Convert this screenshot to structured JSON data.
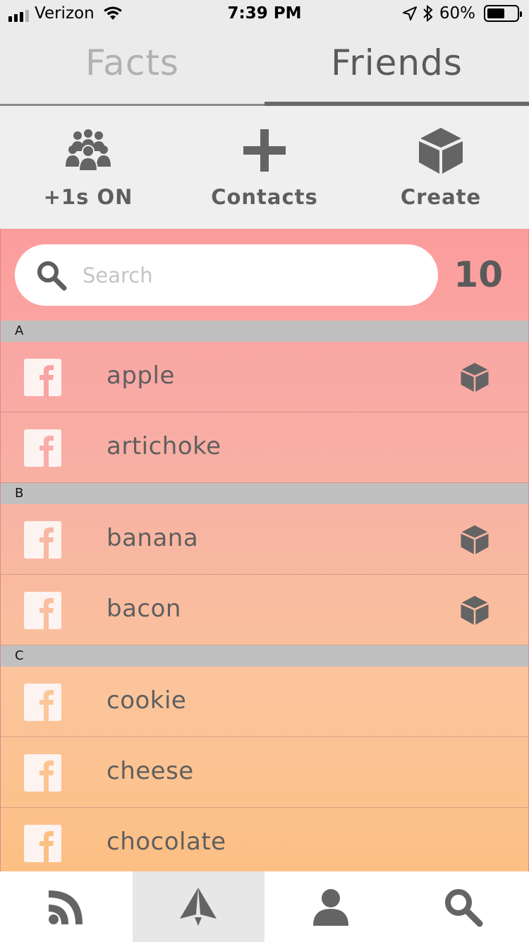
{
  "status_bar": {
    "carrier": "Verizon",
    "time": "7:39 PM",
    "battery_percent": "60%",
    "battery_level": 0.6
  },
  "top_tabs": [
    {
      "label": "Facts",
      "active": false
    },
    {
      "label": "Friends",
      "active": true
    }
  ],
  "actions": {
    "ones_on": "+1s ON",
    "contacts": "Contacts",
    "create": "Create"
  },
  "search": {
    "placeholder": "Search",
    "count": "10"
  },
  "sections": [
    {
      "letter": "A",
      "items": [
        {
          "label": "apple",
          "has_cube": true
        },
        {
          "label": "artichoke",
          "has_cube": false
        }
      ]
    },
    {
      "letter": "B",
      "items": [
        {
          "label": "banana",
          "has_cube": true
        },
        {
          "label": "bacon",
          "has_cube": true
        }
      ]
    },
    {
      "letter": "C",
      "items": [
        {
          "label": "cookie",
          "has_cube": false
        },
        {
          "label": "cheese",
          "has_cube": false
        },
        {
          "label": "chocolate",
          "has_cube": false
        }
      ]
    }
  ],
  "bottom_nav": [
    {
      "icon": "rss-feed-icon",
      "active": false
    },
    {
      "icon": "paper-plane-icon",
      "active": true
    },
    {
      "icon": "person-icon",
      "active": false
    },
    {
      "icon": "search-icon",
      "active": false
    }
  ],
  "colors": {
    "list_top": "#fc9c9c",
    "list_bottom": "#fcc084",
    "icon_gray": "#646464"
  }
}
